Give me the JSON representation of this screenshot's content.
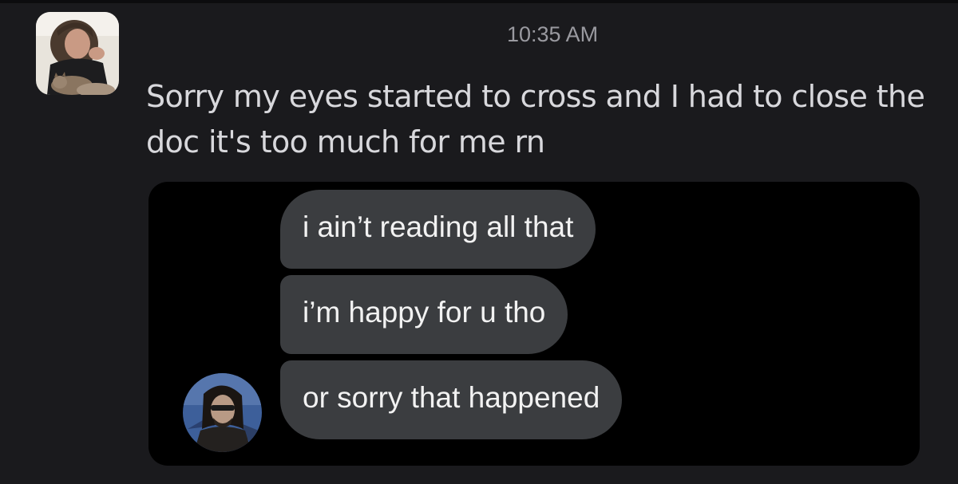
{
  "message": {
    "timestamp": "10:35 AM",
    "text": "Sorry my eyes started to cross and I had to close the doc it's too much for me rn"
  },
  "attachment": {
    "bubbles": [
      "i ain’t reading all that",
      "i’m happy for u tho",
      "or sorry that happened"
    ]
  }
}
